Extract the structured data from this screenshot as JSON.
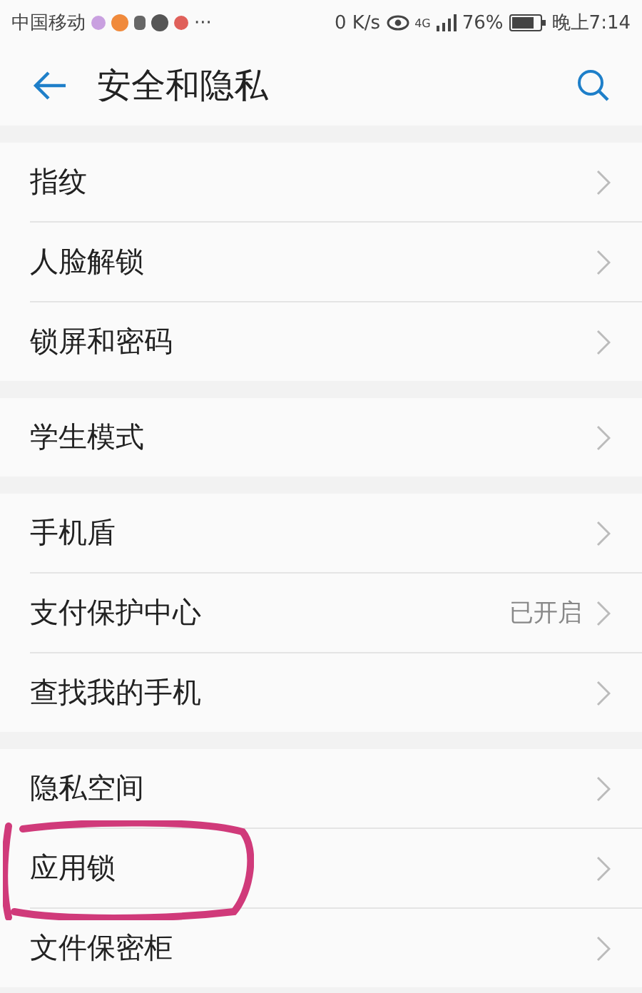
{
  "status_bar": {
    "carrier": "中国移动",
    "more": "···",
    "speed": "0 K/s",
    "network": "4G",
    "battery": "76%",
    "time": "晚上7:14"
  },
  "header": {
    "title": "安全和隐私"
  },
  "groups": [
    {
      "items": [
        {
          "label": "指纹",
          "circled": false
        },
        {
          "label": "人脸解锁",
          "circled": false
        },
        {
          "label": "锁屏和密码",
          "circled": false
        }
      ]
    },
    {
      "items": [
        {
          "label": "学生模式",
          "circled": false
        }
      ]
    },
    {
      "items": [
        {
          "label": "手机盾",
          "circled": false
        },
        {
          "label": "支付保护中心",
          "value": "已开启",
          "circled": false
        },
        {
          "label": "查找我的手机",
          "circled": false
        }
      ]
    },
    {
      "items": [
        {
          "label": "隐私空间",
          "circled": false
        },
        {
          "label": "应用锁",
          "circled": true
        },
        {
          "label": "文件保密柜",
          "circled": false
        }
      ]
    }
  ]
}
